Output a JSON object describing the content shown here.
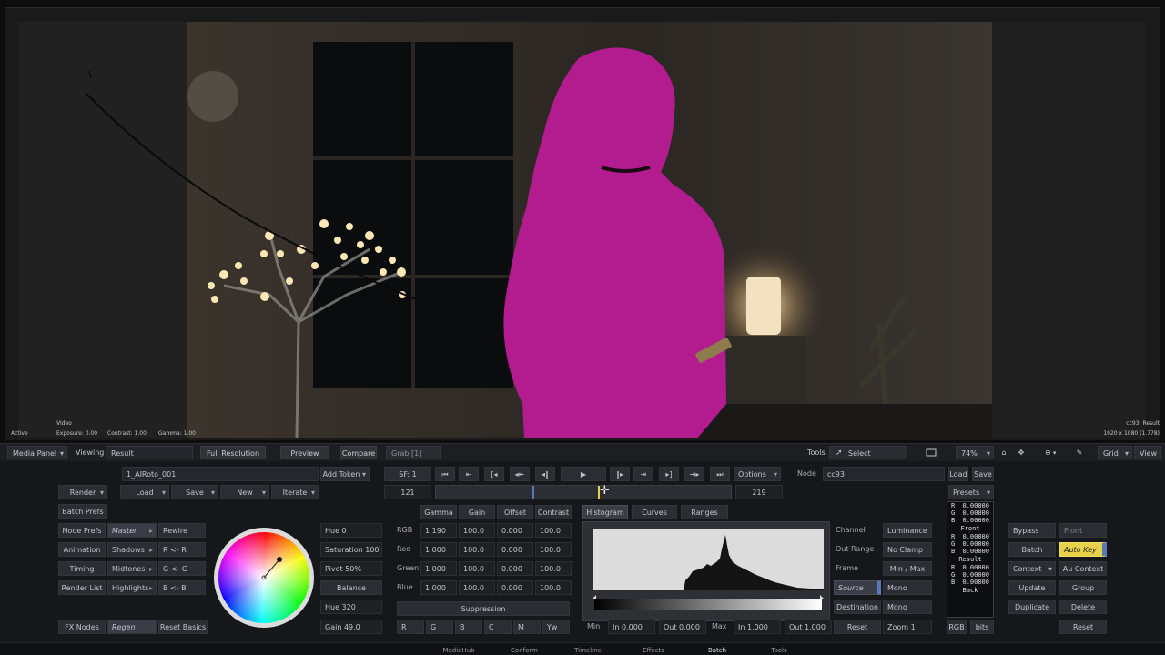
{
  "viewer": {
    "info_left_line1": "Video",
    "info_left_line2": "Active",
    "exposure": "Exposure: 0.00",
    "contrast": "Contrast: 1.00",
    "gamma": "Gamma: 1.00",
    "info_right_line1": "cc93: Result",
    "info_right_line2": "1920 x 1080 (1.778)"
  },
  "toolbar": {
    "media_panel": "Media Panel",
    "viewing_label": "Viewing",
    "viewing_value": "Result",
    "full_resolution": "Full Resolution",
    "preview": "Preview",
    "compare": "Compare",
    "grab": "Grab [1]",
    "tools_label": "Tools",
    "select": "Select",
    "zoom": "74%",
    "grid": "Grid",
    "view": "View"
  },
  "batch": {
    "node_name": "1_AIRoto_001",
    "add_token": "Add Token",
    "render": "Render",
    "load": "Load",
    "save": "Save",
    "new": "New",
    "iterate": "Iterate",
    "batch_prefs": "Batch Prefs",
    "node_prefs": "Node Prefs",
    "animation": "Animation",
    "timing": "Timing",
    "render_list": "Render List",
    "fx_nodes": "FX Nodes"
  },
  "tonal": {
    "master": "Master",
    "shadows": "Shadows",
    "midtones": "Midtones",
    "highlights": "Highlights",
    "regen": "Regen",
    "rewire": "Rewire",
    "r_r": "R <- R",
    "g_g": "G <- G",
    "b_b": "B <- B",
    "reset_basics": "Reset Basics"
  },
  "wheel_controls": {
    "hue": "Hue  0",
    "saturation": "Saturation 100",
    "pivot": "Pivot 50%",
    "balance": "Balance",
    "hue2": "Hue 320",
    "gain2": "Gain 49.0"
  },
  "transport": {
    "sf": "SF: 1",
    "frame_start": "121",
    "frame_end": "219",
    "options": "Options"
  },
  "cc_table": {
    "headers": [
      "Gamma",
      "Gain",
      "Offset",
      "Contrast"
    ],
    "rows": [
      {
        "label": "RGB",
        "values": [
          "1.190",
          "100.0",
          "0.000",
          "100.0"
        ]
      },
      {
        "label": "Red",
        "values": [
          "1.000",
          "100.0",
          "0.000",
          "100.0"
        ]
      },
      {
        "label": "Green",
        "values": [
          "1.000",
          "100.0",
          "0.000",
          "100.0"
        ]
      },
      {
        "label": "Blue",
        "values": [
          "1.000",
          "100.0",
          "0.000",
          "100.0"
        ]
      }
    ],
    "suppression": "Suppression",
    "channels": [
      "R",
      "G",
      "B",
      "C",
      "M",
      "Yw"
    ]
  },
  "histogram": {
    "tabs": [
      "Histogram",
      "Curves",
      "Ranges"
    ],
    "min_label": "Min",
    "in_min": "In 0.000",
    "out_min": "Out 0.000",
    "max_label": "Max",
    "in_max": "In 1.000",
    "out_max": "Out 1.000"
  },
  "node_area": {
    "node_label": "Node",
    "node_value": "cc93",
    "load": "Load",
    "save": "Save",
    "presets": "Presets"
  },
  "channel_settings": {
    "channel": "Channel",
    "channel_value": "Luminance",
    "out_range": "Out Range",
    "out_range_value": "No Clamp",
    "frame": "Frame",
    "frame_value": "Min / Max",
    "source": "Source",
    "source_value": "Mono",
    "destination": "Destination",
    "destination_value": "Mono",
    "reset": "Reset",
    "zoom": "Zoom 1"
  },
  "readout": {
    "top": [
      {
        "ch": "R",
        "v": "0.00000"
      },
      {
        "ch": "G",
        "v": "0.00000"
      },
      {
        "ch": "B",
        "v": "0.00000"
      }
    ],
    "front_label": "Front",
    "front": [
      {
        "ch": "R",
        "v": "0.00000"
      },
      {
        "ch": "G",
        "v": "0.00000"
      },
      {
        "ch": "B",
        "v": "0.00000"
      }
    ],
    "result_label": "Result",
    "result": [
      {
        "ch": "R",
        "v": "0.00000"
      },
      {
        "ch": "G",
        "v": "0.00000"
      },
      {
        "ch": "B",
        "v": "0.00000"
      }
    ],
    "back_label": "Back",
    "rgb": "RGB",
    "bits": "bits"
  },
  "right_controls": {
    "bypass": "Bypass",
    "front": "Front",
    "batch": "Batch",
    "auto_key": "Auto Key",
    "context": "Context",
    "au_context": "Au Context",
    "update": "Update",
    "group": "Group",
    "duplicate": "Duplicate",
    "delete": "Delete",
    "reset": "Reset"
  },
  "bottom_tabs": [
    "MediaHub",
    "Conform",
    "Timeline",
    "Effects",
    "Batch",
    "Tools"
  ],
  "colors": {
    "panel_bg": "#16171a",
    "button_bg": "#2b2d33",
    "accent_yellow": "#e8d24a",
    "matte_magenta": "#b21c8e",
    "selection_blue": "#5a78b8"
  }
}
